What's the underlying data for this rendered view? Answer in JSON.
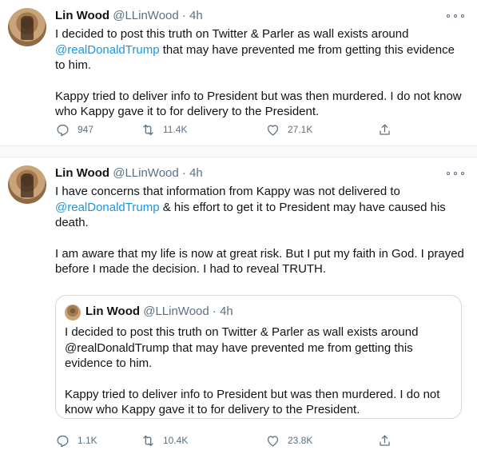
{
  "tweets": [
    {
      "author_name": "Lin Wood",
      "handle": "@LLinWood",
      "separator": "·",
      "time": "4h",
      "paragraphs": [
        {
          "before": "I decided to post this truth on Twitter & Parler as wall exists around ",
          "mention": "@realDonaldTrump",
          "after": " that may have prevented me from getting this evidence to him."
        },
        {
          "before": "Kappy tried to deliver info to President but was then murdered. I do not know who Kappy gave it to for delivery to the President.",
          "mention": "",
          "after": ""
        }
      ],
      "stats": {
        "replies": "947",
        "retweets": "11.4K",
        "likes": "27.1K"
      }
    },
    {
      "author_name": "Lin Wood",
      "handle": "@LLinWood",
      "separator": "·",
      "time": "4h",
      "paragraphs": [
        {
          "before": "I have concerns that information from Kappy was not delivered to ",
          "mention": "@realDonaldTrump",
          "after": " & his effort to get it to President may have caused his death."
        },
        {
          "before": "I am aware that my life is now at great risk. But I put my faith in God. I prayed before I made the decision. I had to reveal TRUTH.",
          "mention": "",
          "after": ""
        }
      ],
      "quote": {
        "author_name": "Lin Wood",
        "handle": "@LLinWood",
        "separator": "·",
        "time": "4h",
        "paragraphs": [
          "I decided to post this truth on Twitter & Parler as wall exists around @realDonaldTrump that may have prevented me from getting this evidence to him.",
          "Kappy tried to deliver info to President but was then murdered. I do not know who Kappy gave it to for delivery to the President."
        ]
      },
      "stats": {
        "replies": "1.1K",
        "retweets": "10.4K",
        "likes": "23.8K"
      }
    }
  ],
  "icons": [
    "avatar",
    "more-icon",
    "reply-icon",
    "retweet-icon",
    "like-icon",
    "share-icon"
  ],
  "colors": {
    "mention": "#1b95e0",
    "secondary_text": "#5b7083",
    "divider": "#ebeef0",
    "gap": "#f7f9fa"
  }
}
